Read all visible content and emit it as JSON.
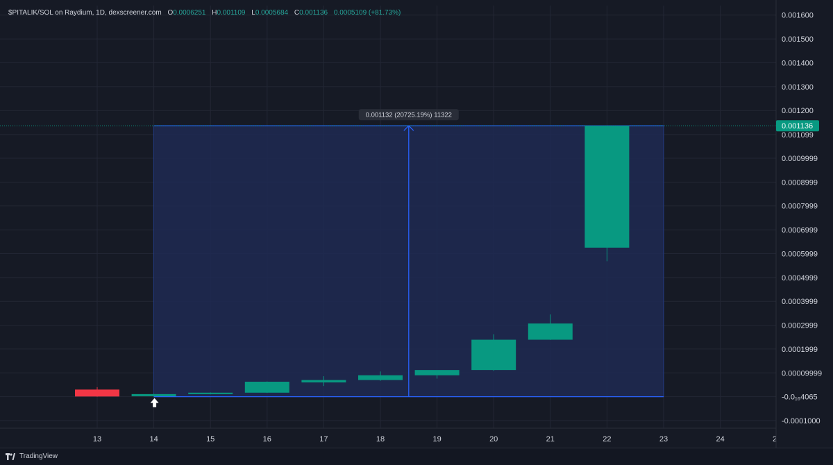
{
  "header": {
    "symbol": "$PITALIK/SOL on Raydium, 1D, dexscreener.com",
    "open_label": "O",
    "open_value": "0.0006251",
    "high_label": "H",
    "high_value": "0.001109",
    "low_label": "L",
    "low_value": "0.0005684",
    "close_label": "C",
    "close_value": "0.001136",
    "change_value": "0.0005109 (+81.73%)"
  },
  "colors": {
    "background": "#161a25",
    "up": "#089981",
    "down": "#f23645",
    "measure_fill": "#1e2a52",
    "measure_line": "#2962ff",
    "grid": "#232735",
    "price_tag": "#089981"
  },
  "measure_tooltip": "0.001132 (20725.19%) 11322",
  "current_price_label": "0.001136",
  "footer": {
    "brand": "TradingView",
    "logo_icon": "tradingview-logo-icon"
  },
  "chart_data": {
    "type": "candlestick",
    "x_tick_labels": [
      "13",
      "14",
      "15",
      "16",
      "17",
      "18",
      "19",
      "20",
      "21",
      "22",
      "23",
      "24",
      "2"
    ],
    "y_tick_labels": [
      "0.001600",
      "0.001500",
      "0.001400",
      "0.001300",
      "0.001200",
      "0.001099",
      "0.0009999",
      "0.0008999",
      "0.0007999",
      "0.0006999",
      "0.0005999",
      "0.0004999",
      "0.0003999",
      "0.0002999",
      "0.0001999",
      "0.00009999",
      "-0.0₁₆4065",
      "-0.0001000"
    ],
    "y_tick_values": [
      0.0016,
      0.0015,
      0.0014,
      0.0013,
      0.0012,
      0.001099,
      0.0009999,
      0.0008999,
      0.0007999,
      0.0006999,
      0.0005999,
      0.0004999,
      0.0003999,
      0.0002999,
      0.0001999,
      9.999e-05,
      0.0,
      -0.0001
    ],
    "ylim": [
      -0.000132,
      0.00164
    ],
    "candles": [
      {
        "day": 13,
        "open": 3e-05,
        "high": 4e-05,
        "low": 0.0,
        "close": 1e-06
      },
      {
        "day": 14,
        "open": 2e-06,
        "high": 1.2e-05,
        "low": 1e-06,
        "close": 1.1e-05
      },
      {
        "day": 15,
        "open": 1.1e-05,
        "high": 1.8e-05,
        "low": 1e-05,
        "close": 1.7e-05
      },
      {
        "day": 16,
        "open": 1.7e-05,
        "high": 6.4e-05,
        "low": 1.6e-05,
        "close": 6.3e-05
      },
      {
        "day": 17,
        "open": 6e-05,
        "high": 8.6e-05,
        "low": 4.5e-05,
        "close": 7e-05
      },
      {
        "day": 18,
        "open": 7e-05,
        "high": 0.000106,
        "low": 6.7e-05,
        "close": 9e-05
      },
      {
        "day": 19,
        "open": 9e-05,
        "high": 0.00011,
        "low": 7.6e-05,
        "close": 0.000112
      },
      {
        "day": 20,
        "open": 0.000112,
        "high": 0.000262,
        "low": 0.000109,
        "close": 0.000239
      },
      {
        "day": 21,
        "open": 0.000239,
        "high": 0.000345,
        "low": 0.000238,
        "close": 0.000307
      },
      {
        "day": 22,
        "open": 0.000625,
        "high": 0.001109,
        "low": 0.000568,
        "close": 0.001136
      }
    ],
    "measure": {
      "from_day": 14,
      "to_day": 23,
      "low_price": 0.0,
      "high_price": 0.001136,
      "marker_day": 14
    },
    "current_price": 0.001136
  }
}
